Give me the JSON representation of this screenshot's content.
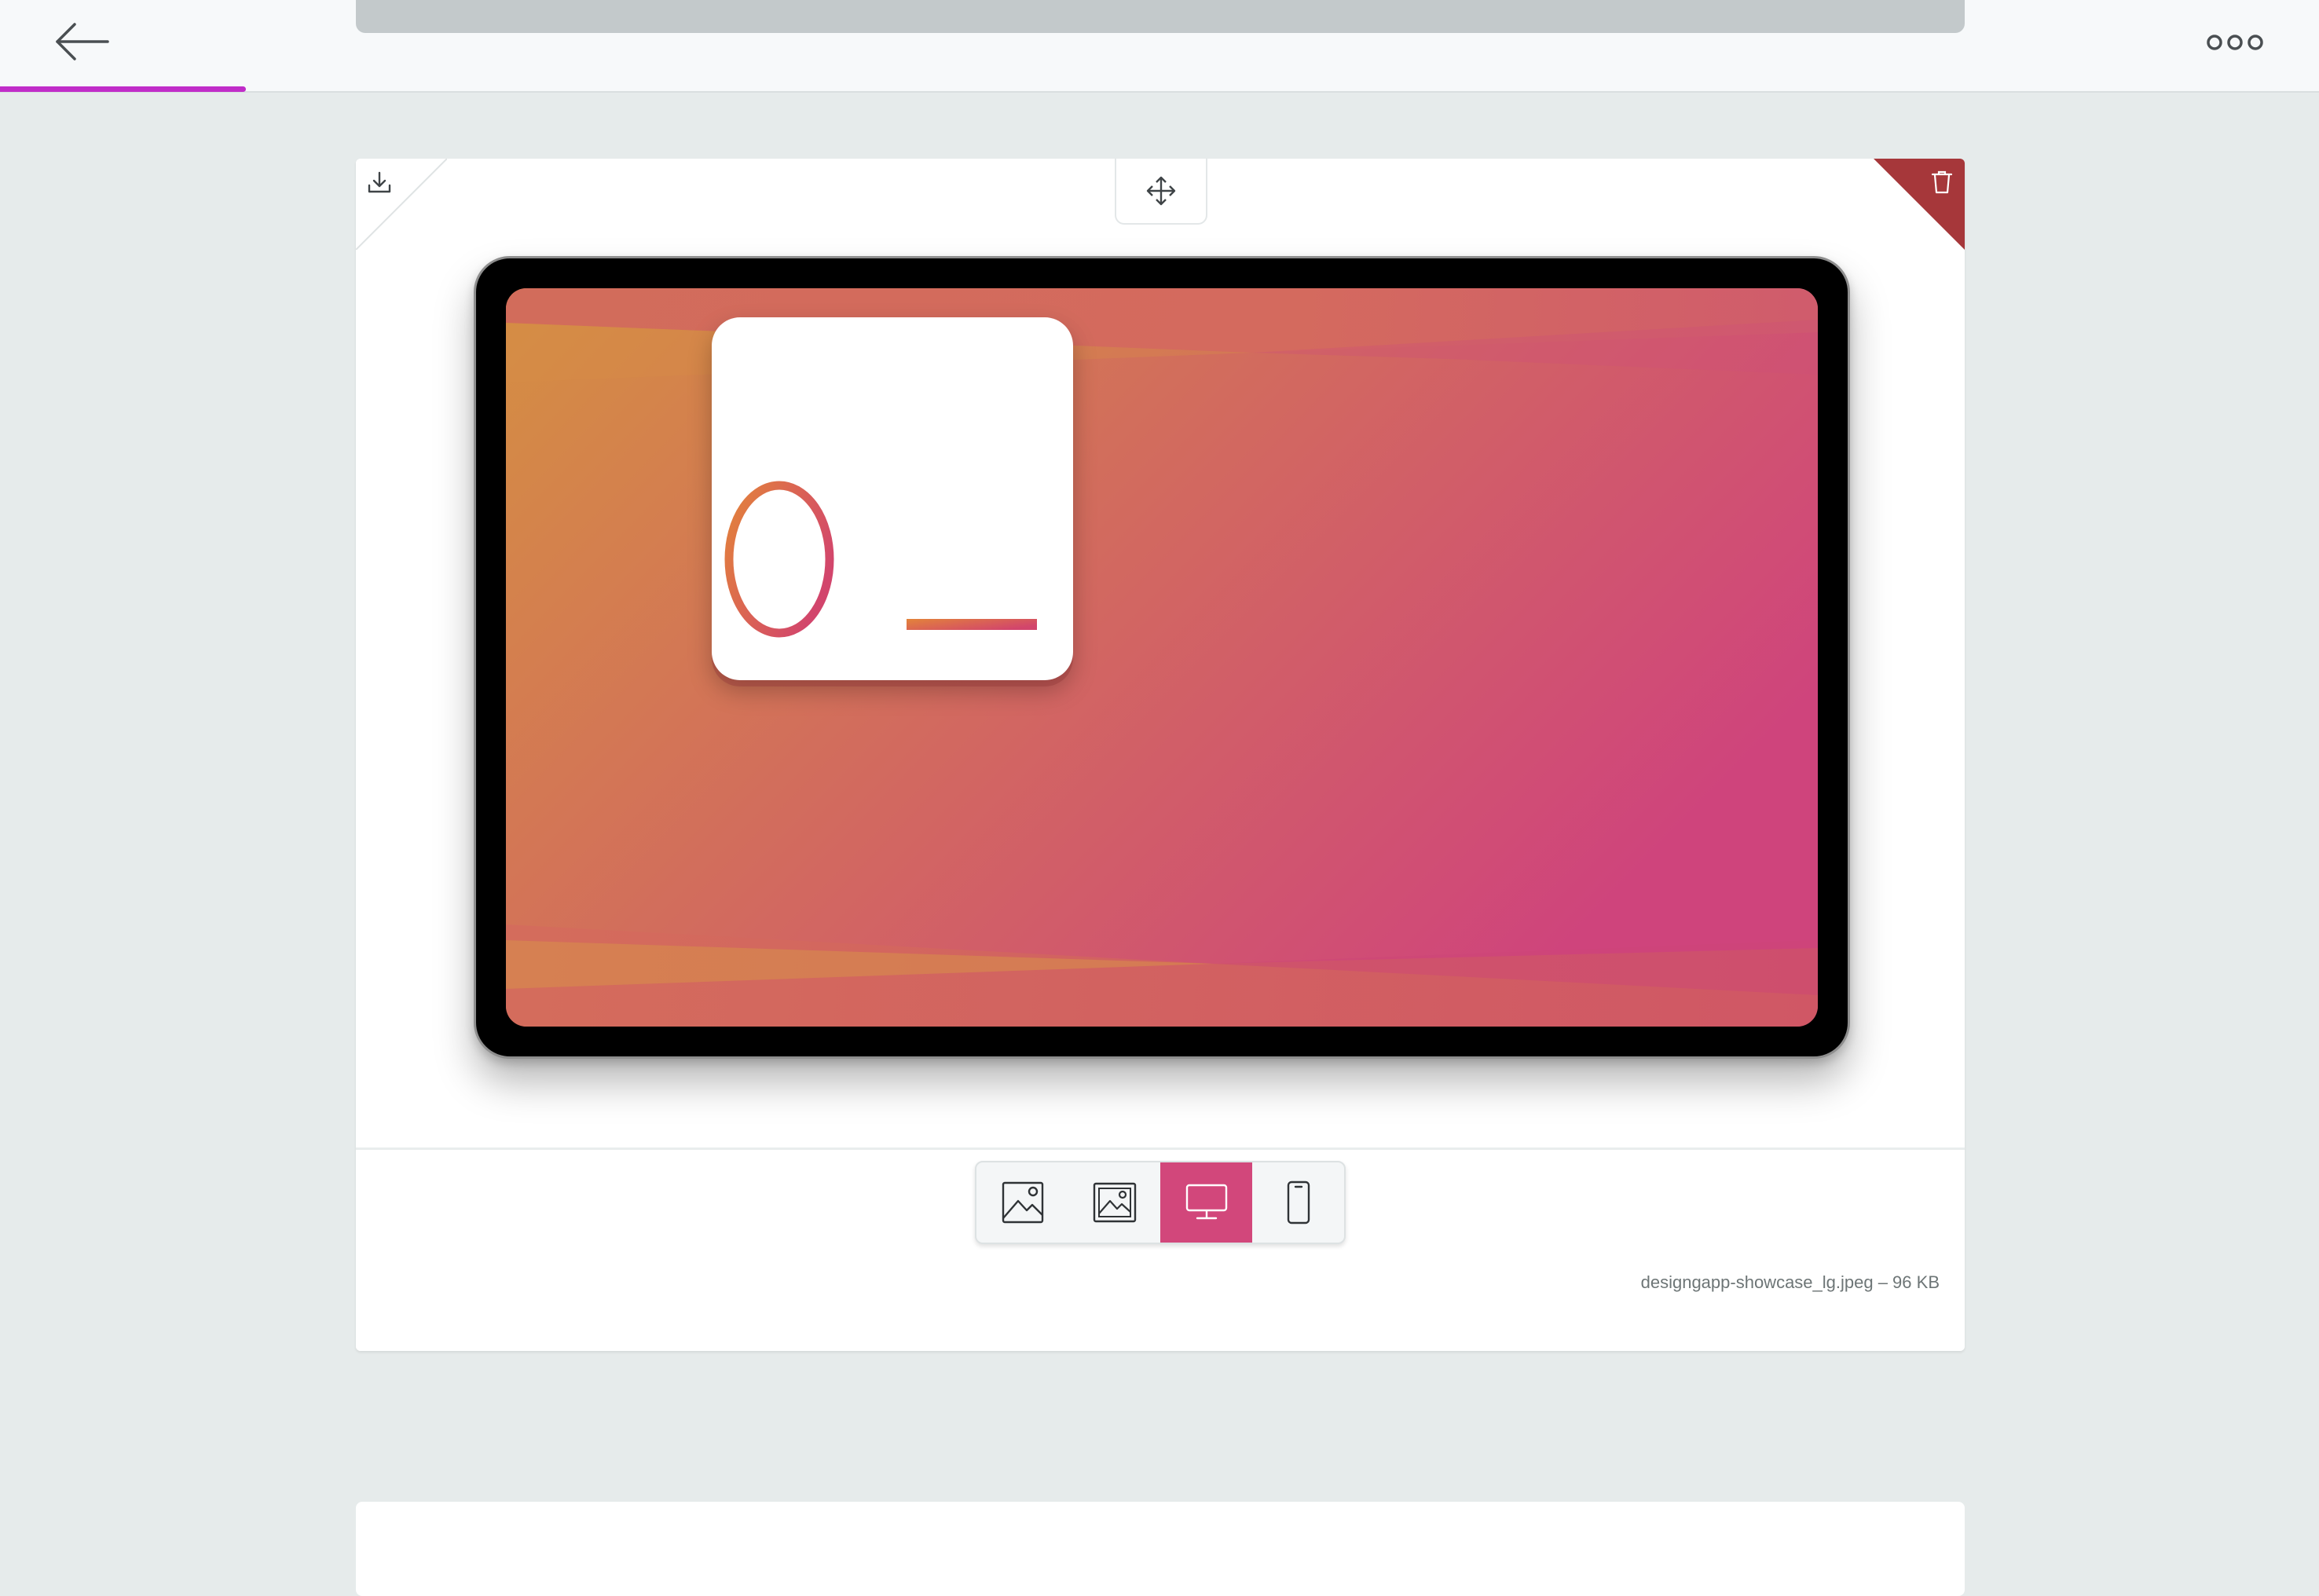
{
  "topbar": {
    "back_icon": "arrow-left-icon",
    "more_icon": "more-horizontal-icon",
    "progress_fraction": 0.106,
    "progress_color": "#c02cc8"
  },
  "preview": {
    "download_icon": "download-icon",
    "delete_icon": "trash-icon",
    "delete_color": "#a6373a",
    "move_icon": "move-arrows-icon",
    "app_glyph": "d_",
    "gradient_start": "#d58f42",
    "gradient_end": "#cf447c"
  },
  "view_modes": [
    {
      "id": "image-plain",
      "icon": "image-icon",
      "active": false
    },
    {
      "id": "image-framed",
      "icon": "image-framed-icon",
      "active": false
    },
    {
      "id": "desktop",
      "icon": "monitor-icon",
      "active": true
    },
    {
      "id": "phone",
      "icon": "phone-icon",
      "active": false
    }
  ],
  "file": {
    "info": "designgapp-showcase_lg.jpeg – 96 KB"
  },
  "colors": {
    "accent": "#d2477b",
    "background": "#e6ebeb"
  }
}
